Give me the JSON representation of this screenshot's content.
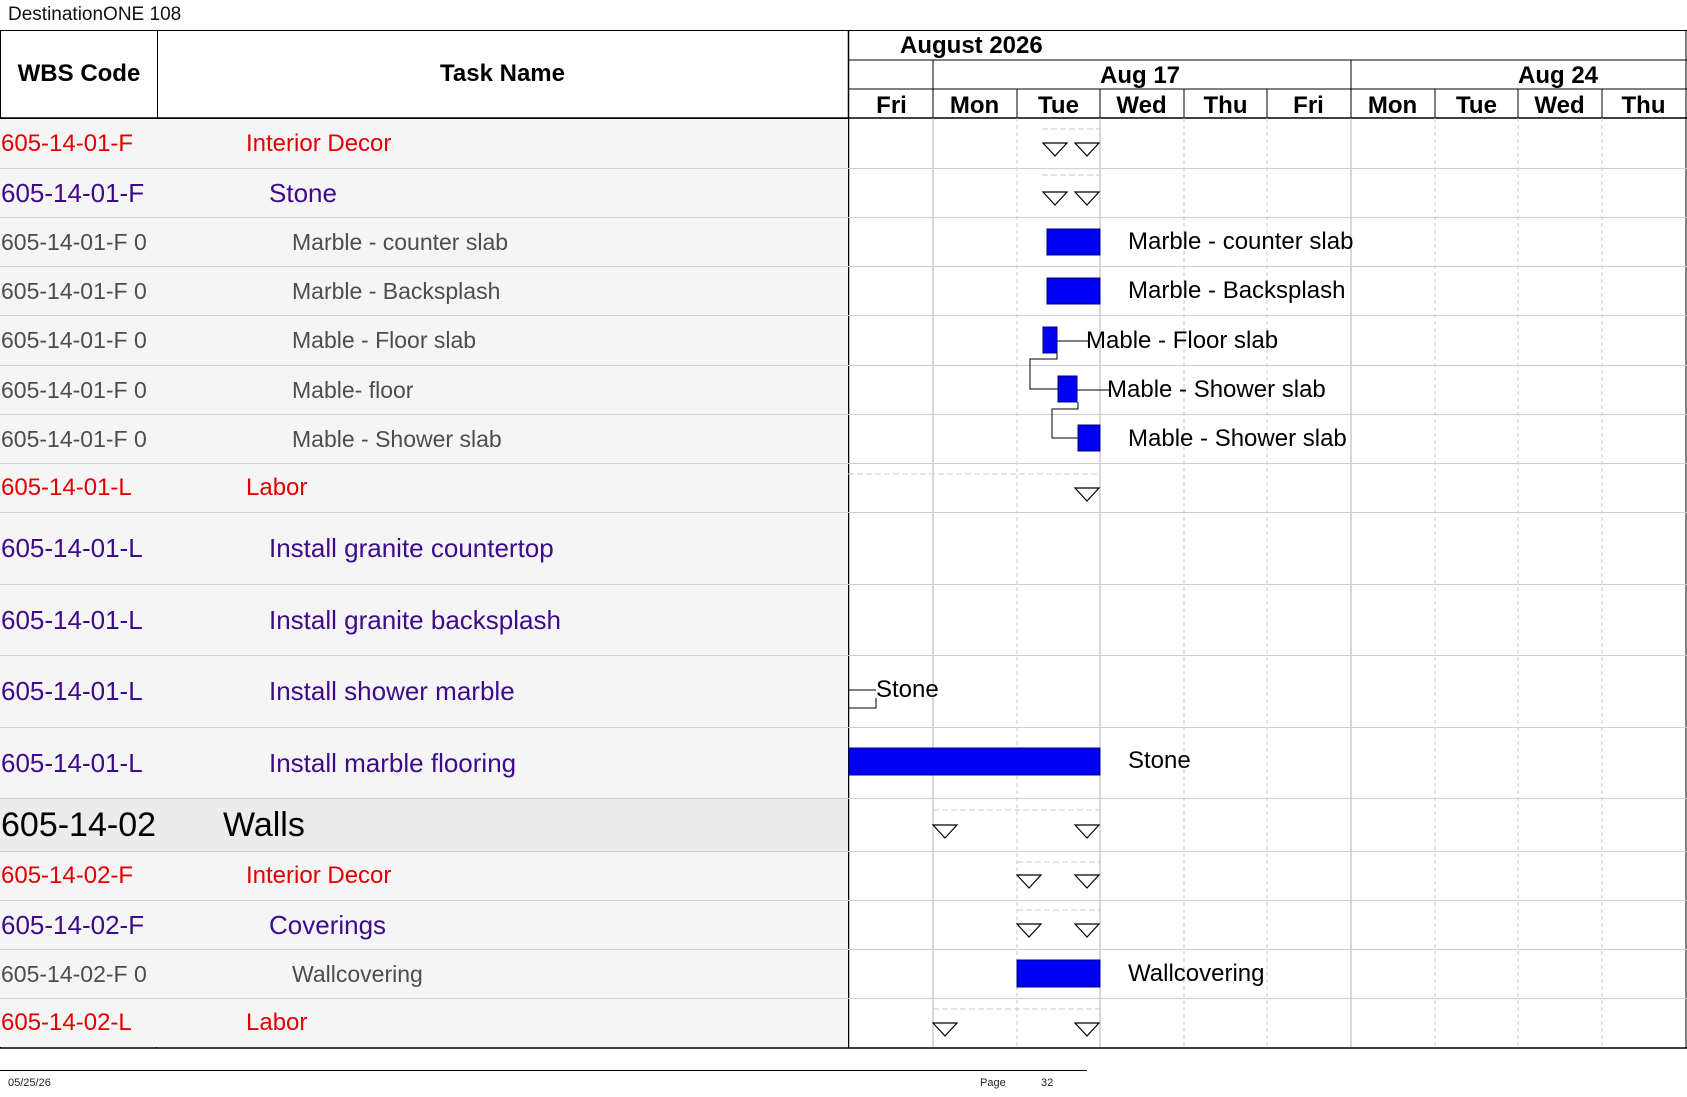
{
  "title": "DestinationONE 108",
  "columns": {
    "wbs": "WBS Code",
    "task": "Task Name"
  },
  "timeline": {
    "month": "August 2026",
    "weeks": [
      "Aug 17",
      "Aug 24"
    ],
    "days": [
      "Fri",
      "Mon",
      "Tue",
      "Wed",
      "Thu",
      "Fri",
      "Mon",
      "Tue",
      "Wed",
      "Thu"
    ]
  },
  "rows": [
    {
      "wbs": "605-14-01-F",
      "task": "Interior Decor",
      "style": "red"
    },
    {
      "wbs": "605-14-01-F",
      "task": "Stone",
      "style": "purple"
    },
    {
      "wbs": "605-14-01-F 0",
      "task": "Marble - counter slab",
      "style": "gray",
      "bar_label": "Marble - counter slab"
    },
    {
      "wbs": "605-14-01-F 0",
      "task": "Marble - Backsplash",
      "style": "gray",
      "bar_label": "Marble - Backsplash"
    },
    {
      "wbs": "605-14-01-F 0",
      "task": "Mable - Floor slab",
      "style": "gray",
      "bar_label": "Mable - Floor slab"
    },
    {
      "wbs": "605-14-01-F 0",
      "task": "Mable- floor",
      "style": "gray",
      "bar_label": "Mable - Shower slab"
    },
    {
      "wbs": "605-14-01-F 0",
      "task": "Mable - Shower slab",
      "style": "gray",
      "bar_label": "Mable - Shower slab"
    },
    {
      "wbs": "605-14-01-L",
      "task": "Labor",
      "style": "red"
    },
    {
      "wbs": "605-14-01-L",
      "task": "Install granite countertop",
      "style": "purple"
    },
    {
      "wbs": "605-14-01-L",
      "task": "Install granite backsplash",
      "style": "purple"
    },
    {
      "wbs": "605-14-01-L",
      "task": "Install shower marble",
      "style": "purple",
      "bar_label": "Stone"
    },
    {
      "wbs": "605-14-01-L",
      "task": "Install marble flooring",
      "style": "purple",
      "bar_label": "Stone"
    },
    {
      "wbs": "605-14-02",
      "task": "Walls",
      "style": "big"
    },
    {
      "wbs": "605-14-02-F",
      "task": "Interior Decor",
      "style": "red"
    },
    {
      "wbs": "605-14-02-F",
      "task": "Coverings",
      "style": "purple"
    },
    {
      "wbs": "605-14-02-F 0",
      "task": "Wallcovering",
      "style": "gray",
      "bar_label": "Wallcovering"
    },
    {
      "wbs": "605-14-02-L",
      "task": "Labor",
      "style": "red"
    }
  ],
  "colors": {
    "bar": "#0000f5",
    "red": "#e00000",
    "purple": "#3d0a8c",
    "gray": "#4d4d4d"
  },
  "footer": {
    "date": "05/25/26",
    "page_label": "Page",
    "page_number": "32"
  }
}
